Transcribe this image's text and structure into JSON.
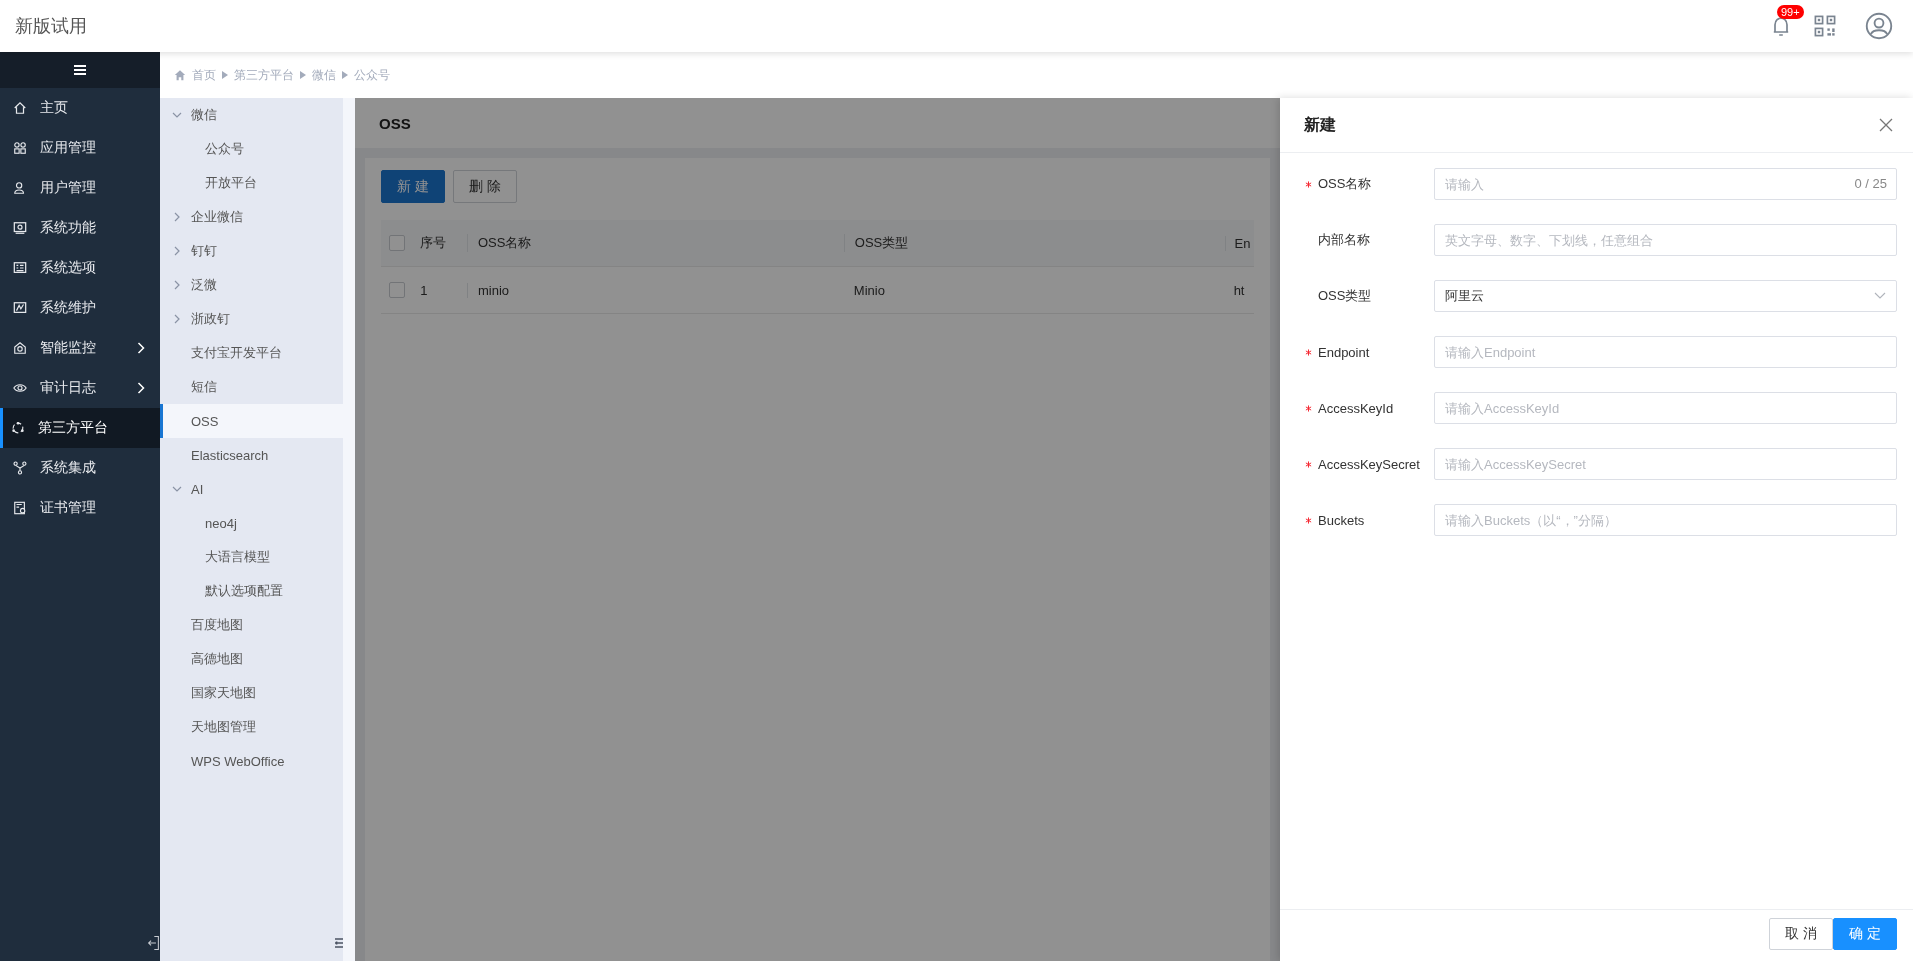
{
  "header": {
    "title": "新版试用",
    "badge": "99+"
  },
  "nav": {
    "items": [
      {
        "label": "主页",
        "expandable": false,
        "selected": false
      },
      {
        "label": "应用管理",
        "expandable": false,
        "selected": false
      },
      {
        "label": "用户管理",
        "expandable": false,
        "selected": false
      },
      {
        "label": "系统功能",
        "expandable": false,
        "selected": false
      },
      {
        "label": "系统选项",
        "expandable": false,
        "selected": false
      },
      {
        "label": "系统维护",
        "expandable": false,
        "selected": false
      },
      {
        "label": "智能监控",
        "expandable": true,
        "selected": false
      },
      {
        "label": "审计日志",
        "expandable": true,
        "selected": false
      },
      {
        "label": "第三方平台",
        "expandable": false,
        "selected": true
      },
      {
        "label": "系统集成",
        "expandable": false,
        "selected": false
      },
      {
        "label": "证书管理",
        "expandable": false,
        "selected": false
      }
    ]
  },
  "breadcrumb": [
    "首页",
    "第三方平台",
    "微信",
    "公众号"
  ],
  "subnav": [
    {
      "kind": "group",
      "label": "微信",
      "expanded": true,
      "children": [
        {
          "label": "公众号",
          "selected": false
        },
        {
          "label": "开放平台",
          "selected": false
        }
      ]
    },
    {
      "kind": "group",
      "label": "企业微信",
      "expanded": false
    },
    {
      "kind": "group",
      "label": "钉钉",
      "expanded": false
    },
    {
      "kind": "group",
      "label": "泛微",
      "expanded": false
    },
    {
      "kind": "group",
      "label": "浙政钉",
      "expanded": false
    },
    {
      "kind": "leaf",
      "label": "支付宝开发平台",
      "selected": false
    },
    {
      "kind": "leaf",
      "label": "短信",
      "selected": false
    },
    {
      "kind": "leaf",
      "label": "OSS",
      "selected": true
    },
    {
      "kind": "leaf",
      "label": "Elasticsearch",
      "selected": false
    },
    {
      "kind": "group",
      "label": "AI",
      "expanded": true,
      "children": [
        {
          "label": "neo4j",
          "selected": false
        },
        {
          "label": "大语言模型",
          "selected": false
        },
        {
          "label": "默认选项配置",
          "selected": false
        }
      ]
    },
    {
      "kind": "leaf",
      "label": "百度地图",
      "selected": false
    },
    {
      "kind": "leaf",
      "label": "高德地图",
      "selected": false
    },
    {
      "kind": "leaf",
      "label": "国家天地图",
      "selected": false
    },
    {
      "kind": "leaf",
      "label": "天地图管理",
      "selected": false
    },
    {
      "kind": "leaf",
      "label": "WPS WebOffice",
      "selected": false
    }
  ],
  "page": {
    "title": "OSS",
    "buttons": [
      {
        "label": "新建",
        "kind": "primary"
      },
      {
        "label": "删除",
        "kind": "default"
      }
    ],
    "table": {
      "all_checked": false,
      "columns": [
        "序号",
        "OSS名称",
        "OSS类型",
        "En"
      ],
      "rows": [
        {
          "checked": false,
          "cells": [
            "1",
            "minio",
            "Minio",
            "ht"
          ]
        }
      ]
    }
  },
  "drawer": {
    "title": "新建",
    "fields": [
      {
        "kind": "input",
        "label": "OSS名称",
        "required": true,
        "placeholder": "请输入",
        "counter": "0 / 25"
      },
      {
        "kind": "input",
        "label": "内部名称",
        "required": false,
        "placeholder": "英文字母、数字、下划线，任意组合"
      },
      {
        "kind": "select",
        "label": "OSS类型",
        "required": false,
        "value": "阿里云"
      },
      {
        "kind": "input",
        "label": "Endpoint",
        "required": true,
        "placeholder": "请输入Endpoint"
      },
      {
        "kind": "input",
        "label": "AccessKeyId",
        "required": true,
        "placeholder": "请输入AccessKeyId"
      },
      {
        "kind": "input",
        "label": "AccessKeySecret",
        "required": true,
        "placeholder": "请输入AccessKeySecret"
      },
      {
        "kind": "input",
        "label": "Buckets",
        "required": true,
        "placeholder": "请输入Buckets（以“，”分隔）"
      }
    ],
    "cancel": "取消",
    "confirm": "确定"
  }
}
